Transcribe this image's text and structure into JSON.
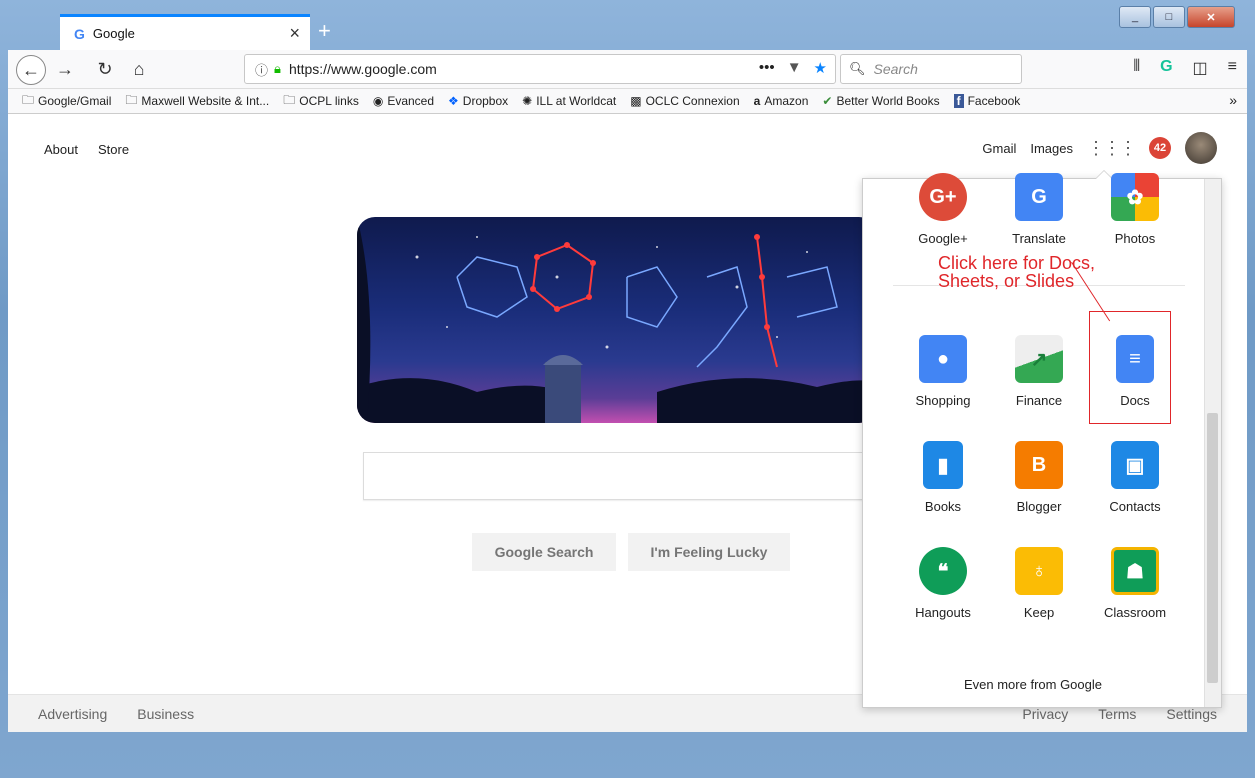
{
  "browser": {
    "tab_title": "Google",
    "tab_icon": "G",
    "url": "https://www.google.com",
    "search_placeholder": "Search",
    "window_controls": {
      "minimize": "_",
      "maximize": "□",
      "close": "✕"
    }
  },
  "bookmarks": [
    {
      "label": "Google/Gmail",
      "icon": "folder-icon"
    },
    {
      "label": "Maxwell Website & Int...",
      "icon": "folder-icon"
    },
    {
      "label": "OCPL links",
      "icon": "folder-icon"
    },
    {
      "label": "Evanced",
      "icon": "globe-icon"
    },
    {
      "label": "Dropbox",
      "icon": "dropbox-icon"
    },
    {
      "label": "ILL at Worldcat",
      "icon": "worldcat-icon"
    },
    {
      "label": "OCLC Connexion",
      "icon": "oclc-icon"
    },
    {
      "label": "Amazon",
      "icon": "amazon-icon"
    },
    {
      "label": "Better World Books",
      "icon": "bwb-icon"
    },
    {
      "label": "Facebook",
      "icon": "facebook-icon"
    }
  ],
  "page": {
    "top_left": [
      "About",
      "Store"
    ],
    "top_right": {
      "gmail": "Gmail",
      "images": "Images",
      "notifications": "42"
    },
    "buttons": {
      "search": "Google Search",
      "lucky": "I'm Feeling Lucky"
    },
    "footer_left": [
      "Advertising",
      "Business"
    ],
    "footer_right": [
      "Privacy",
      "Terms",
      "Settings"
    ]
  },
  "apps_panel": {
    "apps": [
      {
        "label": "Google+",
        "color": "#dd4b39",
        "glyph": "G+"
      },
      {
        "label": "Translate",
        "color": "#4285f4",
        "glyph": "G"
      },
      {
        "label": "Photos",
        "color": "#fbbc05",
        "glyph": "✿"
      },
      {
        "label": "Shopping",
        "color": "#4285f4",
        "glyph": "●"
      },
      {
        "label": "Finance",
        "color": "#34a853",
        "glyph": "↗"
      },
      {
        "label": "Docs",
        "color": "#4285f4",
        "glyph": "≡"
      },
      {
        "label": "Books",
        "color": "#1e88e5",
        "glyph": "▮"
      },
      {
        "label": "Blogger",
        "color": "#f57c00",
        "glyph": "B"
      },
      {
        "label": "Contacts",
        "color": "#1e88e5",
        "glyph": "▣"
      },
      {
        "label": "Hangouts",
        "color": "#0f9d58",
        "glyph": "❝"
      },
      {
        "label": "Keep",
        "color": "#fbbc05",
        "glyph": "♁"
      },
      {
        "label": "Classroom",
        "color": "#0f9d58",
        "glyph": "☗"
      }
    ],
    "more_label": "Even more from Google"
  },
  "annotation": {
    "text": "Click here for Docs, Sheets, or Slides"
  }
}
